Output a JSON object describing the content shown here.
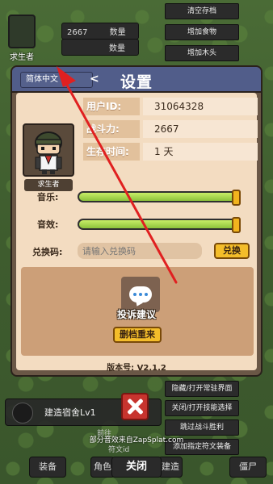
{
  "background": {
    "player_label": "求生者",
    "stat_top": "2667",
    "stat_top_label": "数量",
    "stat_second_label": "数量",
    "cheat_buttons": [
      "清空存档",
      "增加食物",
      "增加木头",
      "",
      "",
      "",
      ""
    ],
    "cheat_buttons_low": [
      "隐藏/打开常驻界面",
      "关闭/打开技能选择",
      "跳过战斗胜利",
      "添加指定符文装备"
    ],
    "build_label": "建造宿舍Lv1",
    "build_sub": "前往",
    "build_sub2": "符文id",
    "bottom_tabs": [
      "装备",
      "角色",
      "建造",
      "僵尸"
    ],
    "credit": "部分音效来自ZapSplat.com",
    "close_label": "关闭"
  },
  "dialog": {
    "language": "简体中文",
    "language_arrow": "<",
    "title": "设置",
    "avatar_name": "求生者",
    "info": [
      {
        "label": "用户ID:",
        "value": "31064328"
      },
      {
        "label": "战斗力:",
        "value": "2667"
      },
      {
        "label": "生存时间:",
        "value": "1 天"
      }
    ],
    "music_label": "音乐:",
    "music_level": 1.0,
    "sfx_label": "音效:",
    "sfx_level": 1.0,
    "code_label": "兑换码:",
    "code_placeholder": "请输入兑换码",
    "redeem_label": "兑换",
    "feedback_label": "投诉建议",
    "delete_label": "删档重来",
    "version": "版本号: V2.1.2"
  },
  "colors": {
    "title_bar": "#515d8a",
    "panel": "#f3dcc1",
    "button": "#f4bd2a",
    "slider_fill": "#8cc23b",
    "close_button": "#c7342e",
    "annotation_arrow": "#e02020"
  },
  "icons": {
    "close": "close-x-icon",
    "feedback": "chat-bubble-icon"
  }
}
